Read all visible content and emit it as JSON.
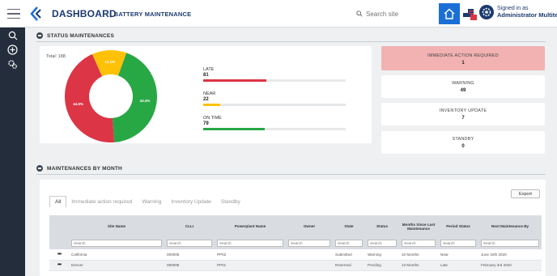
{
  "header": {
    "title": "DASHBOARD",
    "subtitle": "| BATTERY MAINTENANCE",
    "search_placeholder": "Search site",
    "user_line1": "Signed in as",
    "user_line2": "Administrator Multitel"
  },
  "colors": {
    "late": "#dc3545",
    "near": "#ffc107",
    "on_time": "#28a745",
    "brand": "#1b3a70",
    "accent": "#1a6fd6"
  },
  "status_section": {
    "title": "STATUS MAINTENANCES",
    "total": "Total: 188"
  },
  "chart_data": {
    "type": "pie",
    "categories": [
      "LATE",
      "NEAR",
      "ON TIME"
    ],
    "values": [
      81,
      22,
      79
    ],
    "slice_labels": [
      "44.5%",
      "12.1%",
      "43.4%"
    ],
    "colors": [
      "#dc3545",
      "#ffc107",
      "#28a745"
    ]
  },
  "legend": [
    {
      "name": "LATE",
      "value": "81",
      "fraction": 0.445,
      "color": "#dc3545"
    },
    {
      "name": "NEAR",
      "value": "22",
      "fraction": 0.121,
      "color": "#ffc107"
    },
    {
      "name": "ON TIME",
      "value": "79",
      "fraction": 0.434,
      "color": "#28a745"
    }
  ],
  "stats": [
    {
      "label": "IMMEDIATE ACTION REQUIRED",
      "count": "1"
    },
    {
      "label": "WARNING",
      "count": "49"
    },
    {
      "label": "INVENTORY UPDATE",
      "count": "7"
    },
    {
      "label": "STANDBY",
      "count": "0"
    }
  ],
  "month_section": {
    "title": "MAINTENANCES BY MONTH"
  },
  "tabs": [
    "All",
    "Immediate action required",
    "Warning",
    "Inventory Update",
    "Standby"
  ],
  "export_label": "Export",
  "table": {
    "columns": [
      "Site Name",
      "CLLI",
      "Powerplant Name",
      "Owner",
      "State",
      "Status",
      "Months Since Last Maintenance",
      "Period Status",
      "Next Maintenance By"
    ],
    "filter_placeholder": "Search",
    "rows": [
      {
        "actions": "•••",
        "cells": [
          "California",
          "000005",
          "PP02",
          "",
          "Submitted",
          "Warning",
          "10 Months",
          "Near",
          "June 10th 2020"
        ]
      },
      {
        "actions": "•••",
        "cells": [
          "Denver",
          "080088",
          "PP01",
          "",
          "Reserved",
          "Pending",
          "13 Months",
          "Late",
          "February 3rd 2020"
        ]
      }
    ]
  }
}
